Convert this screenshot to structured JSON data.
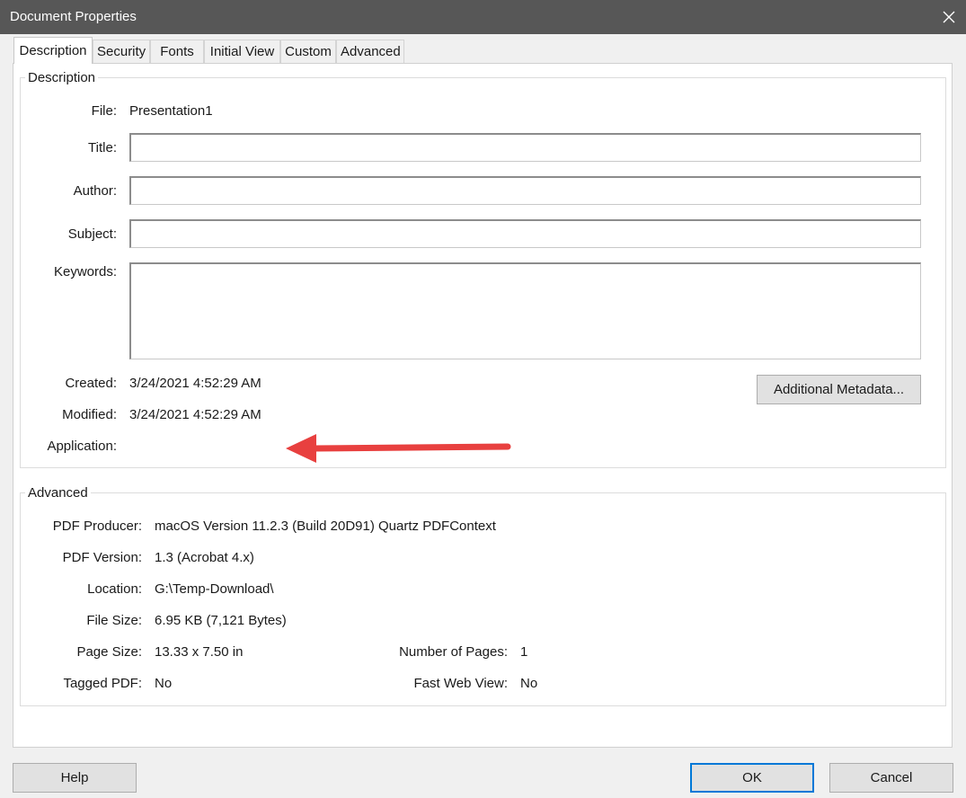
{
  "window": {
    "title": "Document Properties",
    "close_icon": "close-icon"
  },
  "tabs": [
    "Description",
    "Security",
    "Fonts",
    "Initial View",
    "Custom",
    "Advanced"
  ],
  "description": {
    "legend": "Description",
    "file_label": "File:",
    "file_value": "Presentation1",
    "title_label": "Title:",
    "title_value": "",
    "author_label": "Author:",
    "author_value": "",
    "subject_label": "Subject:",
    "subject_value": "",
    "keywords_label": "Keywords:",
    "keywords_value": "",
    "created_label": "Created:",
    "created_value": "3/24/2021 4:52:29 AM",
    "modified_label": "Modified:",
    "modified_value": "3/24/2021 4:52:29 AM",
    "application_label": "Application:",
    "application_value": "",
    "metadata_button": "Additional Metadata...",
    "annotation_arrow_color": "#e8403f"
  },
  "advanced": {
    "legend": "Advanced",
    "producer_label": "PDF Producer:",
    "producer_value": "macOS Version 11.2.3 (Build 20D91) Quartz PDFContext",
    "version_label": "PDF Version:",
    "version_value": "1.3 (Acrobat 4.x)",
    "location_label": "Location:",
    "location_value": "G:\\Temp-Download\\",
    "filesize_label": "File Size:",
    "filesize_value": "6.95 KB (7,121 Bytes)",
    "pagesize_label": "Page Size:",
    "pagesize_value": "13.33 x 7.50 in",
    "numpages_label": "Number of Pages:",
    "numpages_value": "1",
    "tagged_label": "Tagged PDF:",
    "tagged_value": "No",
    "fastweb_label": "Fast Web View:",
    "fastweb_value": "No"
  },
  "footer": {
    "help": "Help",
    "ok": "OK",
    "cancel": "Cancel"
  },
  "colors": {
    "titlebar": "#575757",
    "default_button_border": "#0078d7"
  }
}
